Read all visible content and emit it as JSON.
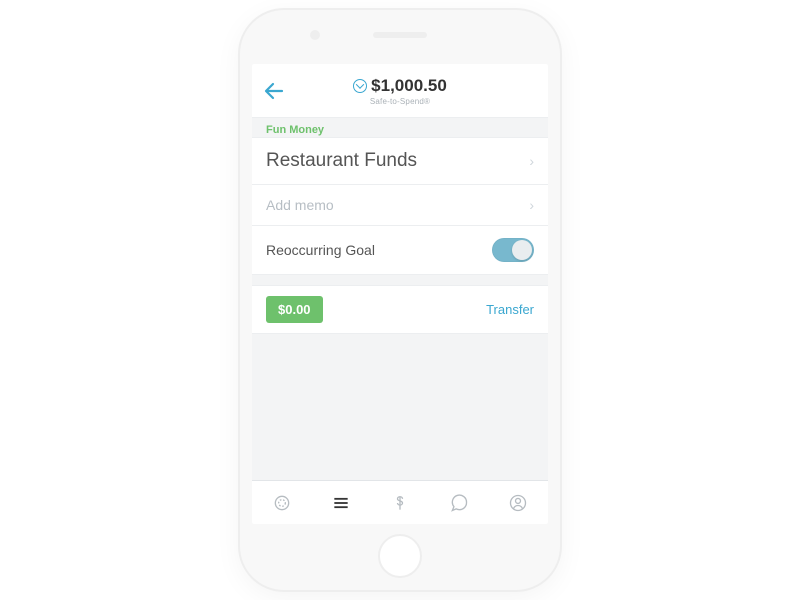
{
  "header": {
    "balance": "$1,000.50",
    "subtitle": "Safe-to-Spend®"
  },
  "category": "Fun Money",
  "goal": {
    "name": "Restaurant Funds",
    "memo_placeholder": "Add memo",
    "recurring_label": "Reoccurring Goal",
    "recurring_on": true,
    "balance": "$0.00",
    "transfer_label": "Transfer"
  },
  "tabs": {
    "active_index": 1
  }
}
